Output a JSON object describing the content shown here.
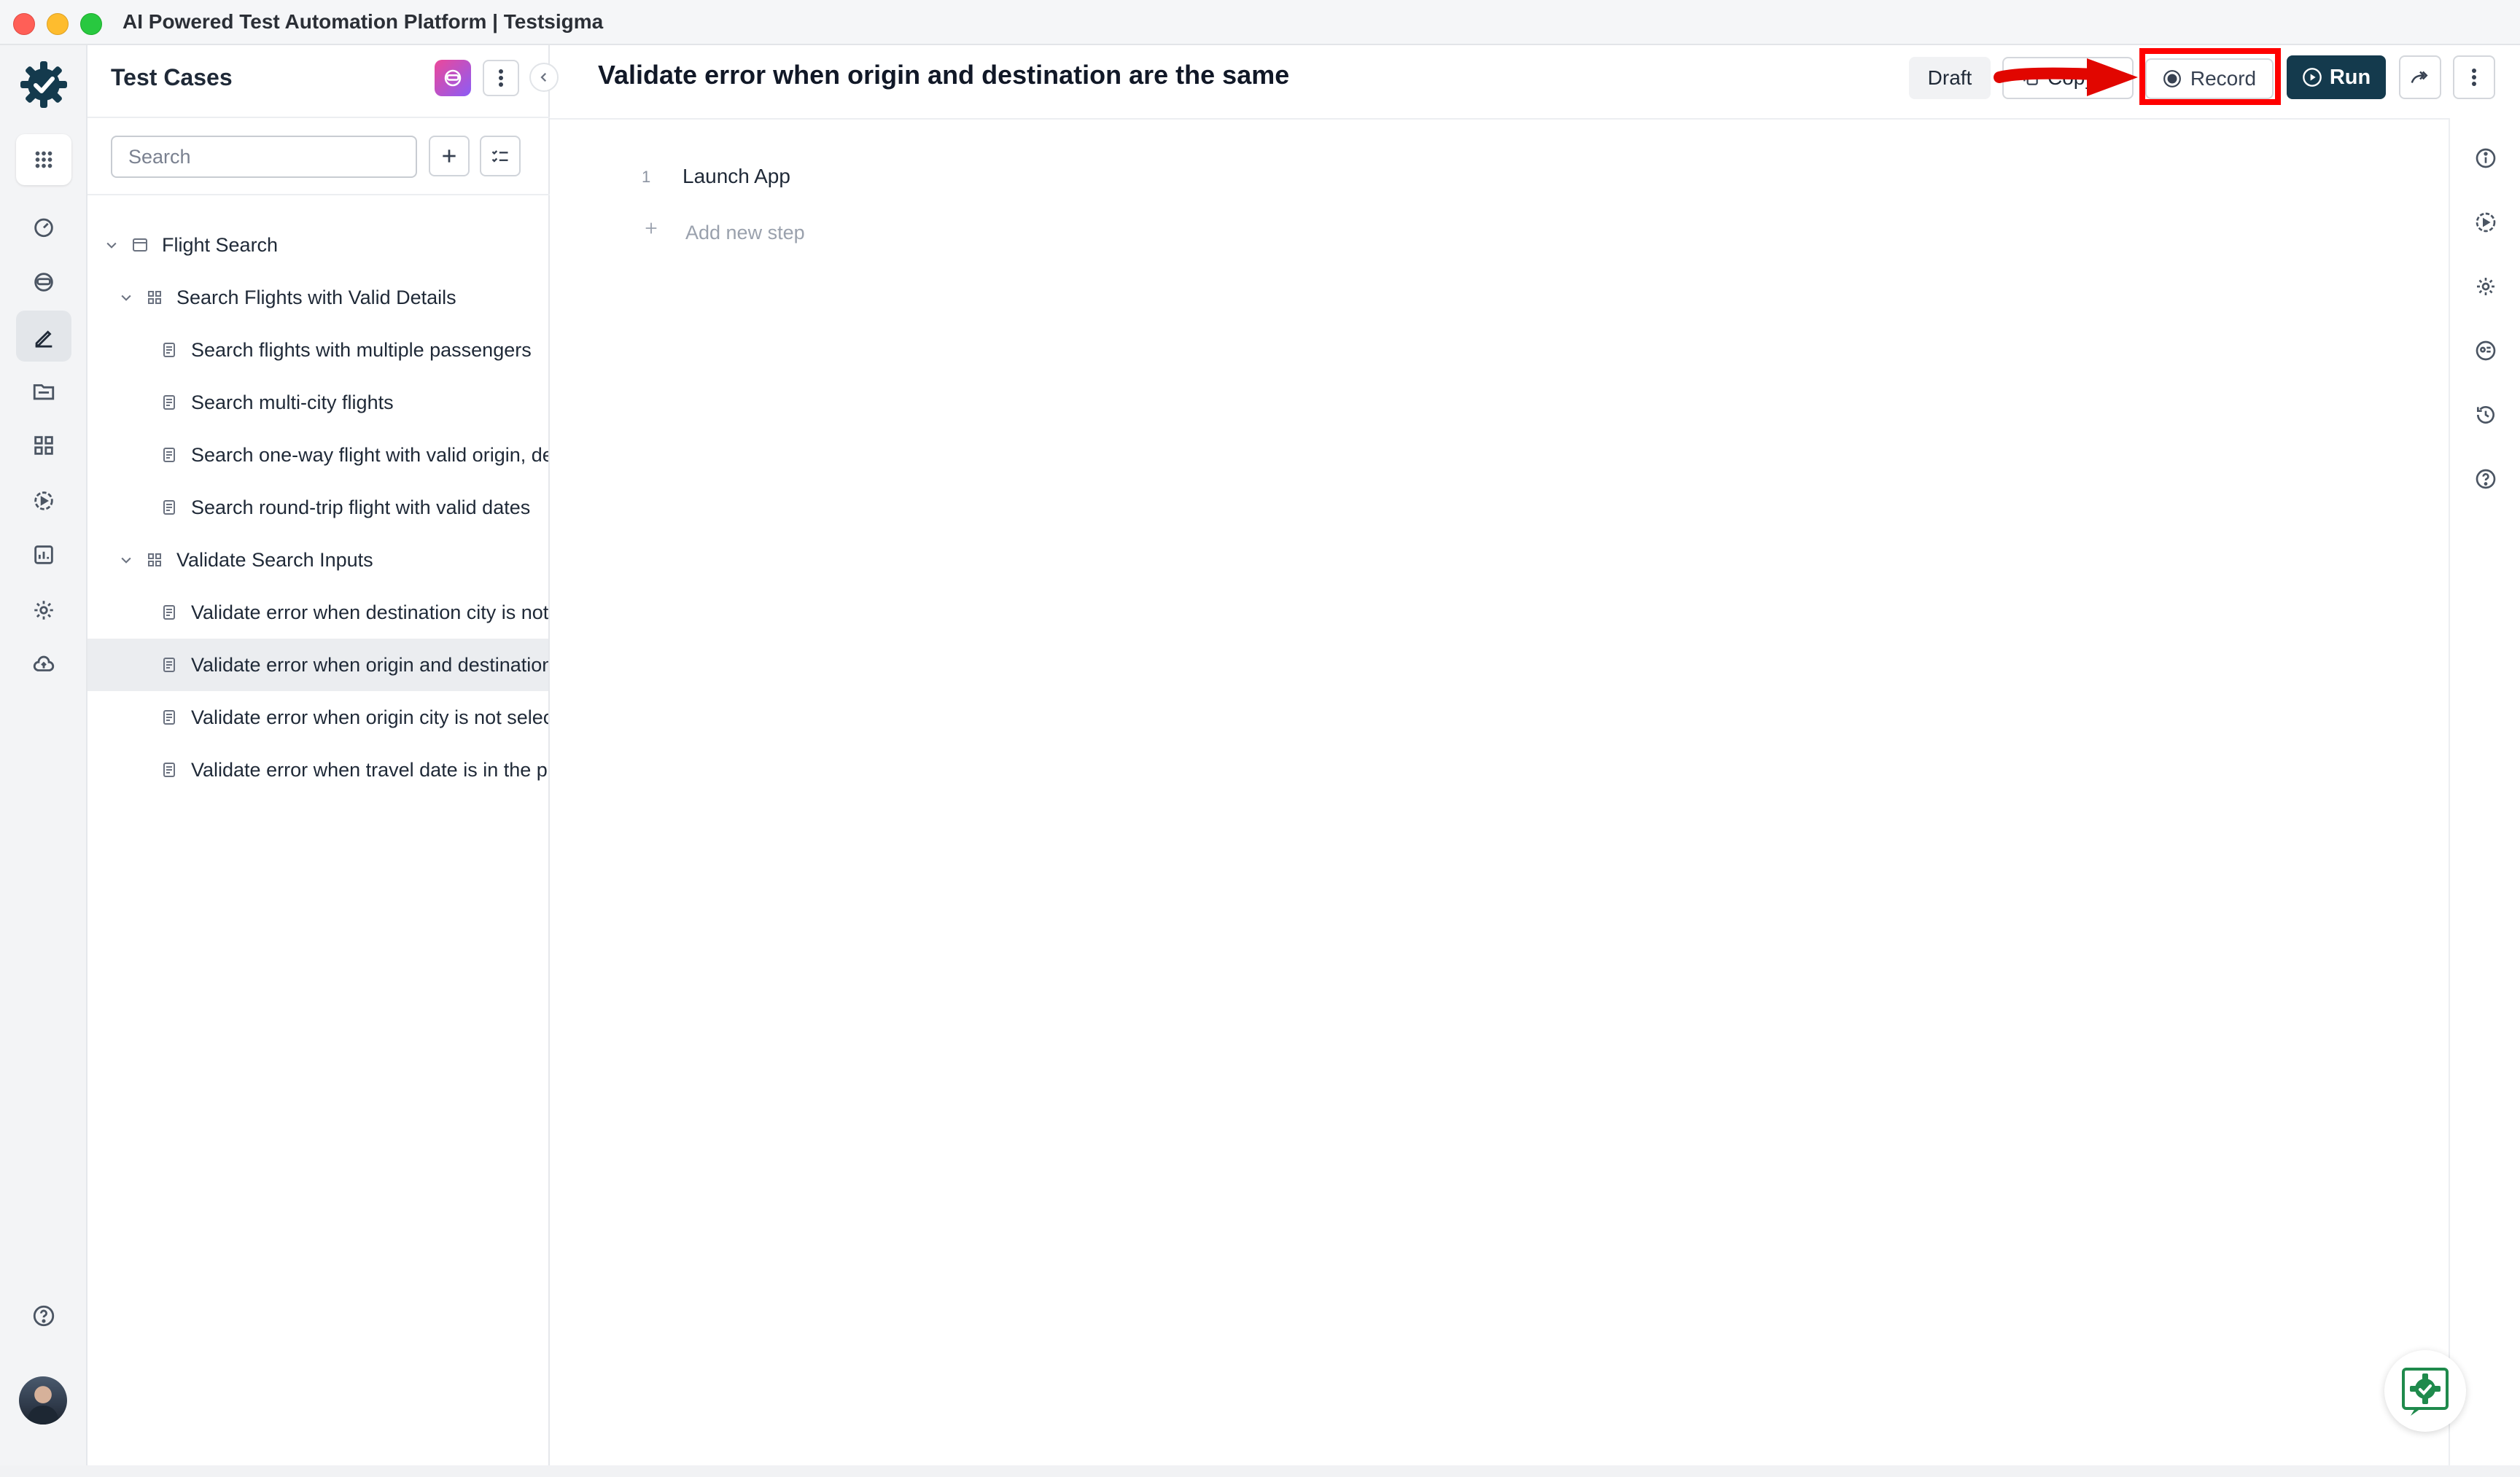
{
  "window": {
    "title": "AI Powered Test Automation Platform | Testsigma"
  },
  "rail": {
    "items": [
      {
        "icon": "apps-grid-icon"
      },
      {
        "icon": "dashboard-icon"
      },
      {
        "icon": "ai-agent-icon"
      },
      {
        "icon": "test-cases-icon",
        "active": true
      },
      {
        "icon": "folder-icon"
      },
      {
        "icon": "modules-icon"
      },
      {
        "icon": "run-icon"
      },
      {
        "icon": "reports-icon"
      },
      {
        "icon": "settings-icon"
      },
      {
        "icon": "cloud-icon"
      },
      {
        "icon": "help-icon"
      }
    ]
  },
  "tree": {
    "title": "Test Cases",
    "search_placeholder": "Search",
    "nodes": [
      {
        "label": "Flight Search",
        "type": "folder"
      },
      {
        "label": "Search Flights with Valid Details",
        "type": "group"
      },
      {
        "label": "Search flights with multiple passengers",
        "type": "case"
      },
      {
        "label": "Search multi-city flights",
        "type": "case"
      },
      {
        "label": "Search one-way flight with valid origin, destination, and date",
        "type": "case"
      },
      {
        "label": "Search round-trip flight with valid dates",
        "type": "case"
      },
      {
        "label": "Validate Search Inputs",
        "type": "group"
      },
      {
        "label": "Validate error when destination city is not selected",
        "type": "case"
      },
      {
        "label": "Validate error when origin and destination are the same",
        "type": "case",
        "selected": true
      },
      {
        "label": "Validate error when origin city is not selected",
        "type": "case"
      },
      {
        "label": "Validate error when travel date is in the past",
        "type": "case"
      }
    ]
  },
  "main": {
    "title": "Validate error when origin and destination are the same",
    "status": "Draft",
    "copy_label": "Copy",
    "record_label": "Record",
    "run_label": "Run",
    "steps": [
      {
        "num": "1",
        "text": "Launch App"
      }
    ],
    "add_step_label": "Add new step"
  },
  "colors": {
    "accent": "#143a4d",
    "highlight": "#ff0000",
    "selected_row": "#ebedf0"
  }
}
